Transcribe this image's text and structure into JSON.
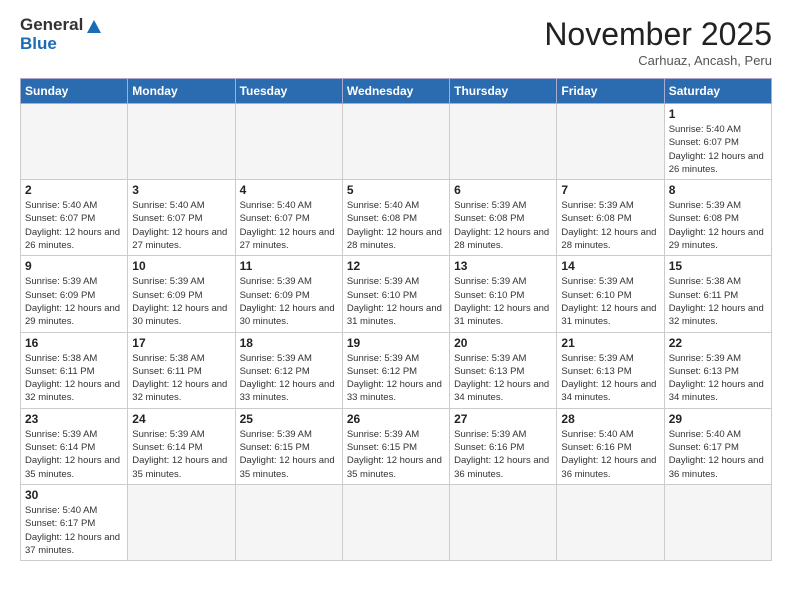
{
  "logo": {
    "line1": "General",
    "line2": "Blue"
  },
  "header": {
    "month": "November 2025",
    "location": "Carhuaz, Ancash, Peru"
  },
  "weekdays": [
    "Sunday",
    "Monday",
    "Tuesday",
    "Wednesday",
    "Thursday",
    "Friday",
    "Saturday"
  ],
  "weeks": [
    [
      {
        "day": "",
        "info": ""
      },
      {
        "day": "",
        "info": ""
      },
      {
        "day": "",
        "info": ""
      },
      {
        "day": "",
        "info": ""
      },
      {
        "day": "",
        "info": ""
      },
      {
        "day": "",
        "info": ""
      },
      {
        "day": "1",
        "info": "Sunrise: 5:40 AM\nSunset: 6:07 PM\nDaylight: 12 hours\nand 26 minutes."
      }
    ],
    [
      {
        "day": "2",
        "info": "Sunrise: 5:40 AM\nSunset: 6:07 PM\nDaylight: 12 hours\nand 26 minutes."
      },
      {
        "day": "3",
        "info": "Sunrise: 5:40 AM\nSunset: 6:07 PM\nDaylight: 12 hours\nand 27 minutes."
      },
      {
        "day": "4",
        "info": "Sunrise: 5:40 AM\nSunset: 6:07 PM\nDaylight: 12 hours\nand 27 minutes."
      },
      {
        "day": "5",
        "info": "Sunrise: 5:40 AM\nSunset: 6:08 PM\nDaylight: 12 hours\nand 28 minutes."
      },
      {
        "day": "6",
        "info": "Sunrise: 5:39 AM\nSunset: 6:08 PM\nDaylight: 12 hours\nand 28 minutes."
      },
      {
        "day": "7",
        "info": "Sunrise: 5:39 AM\nSunset: 6:08 PM\nDaylight: 12 hours\nand 28 minutes."
      },
      {
        "day": "8",
        "info": "Sunrise: 5:39 AM\nSunset: 6:08 PM\nDaylight: 12 hours\nand 29 minutes."
      }
    ],
    [
      {
        "day": "9",
        "info": "Sunrise: 5:39 AM\nSunset: 6:09 PM\nDaylight: 12 hours\nand 29 minutes."
      },
      {
        "day": "10",
        "info": "Sunrise: 5:39 AM\nSunset: 6:09 PM\nDaylight: 12 hours\nand 30 minutes."
      },
      {
        "day": "11",
        "info": "Sunrise: 5:39 AM\nSunset: 6:09 PM\nDaylight: 12 hours\nand 30 minutes."
      },
      {
        "day": "12",
        "info": "Sunrise: 5:39 AM\nSunset: 6:10 PM\nDaylight: 12 hours\nand 31 minutes."
      },
      {
        "day": "13",
        "info": "Sunrise: 5:39 AM\nSunset: 6:10 PM\nDaylight: 12 hours\nand 31 minutes."
      },
      {
        "day": "14",
        "info": "Sunrise: 5:39 AM\nSunset: 6:10 PM\nDaylight: 12 hours\nand 31 minutes."
      },
      {
        "day": "15",
        "info": "Sunrise: 5:38 AM\nSunset: 6:11 PM\nDaylight: 12 hours\nand 32 minutes."
      }
    ],
    [
      {
        "day": "16",
        "info": "Sunrise: 5:38 AM\nSunset: 6:11 PM\nDaylight: 12 hours\nand 32 minutes."
      },
      {
        "day": "17",
        "info": "Sunrise: 5:38 AM\nSunset: 6:11 PM\nDaylight: 12 hours\nand 32 minutes."
      },
      {
        "day": "18",
        "info": "Sunrise: 5:39 AM\nSunset: 6:12 PM\nDaylight: 12 hours\nand 33 minutes."
      },
      {
        "day": "19",
        "info": "Sunrise: 5:39 AM\nSunset: 6:12 PM\nDaylight: 12 hours\nand 33 minutes."
      },
      {
        "day": "20",
        "info": "Sunrise: 5:39 AM\nSunset: 6:13 PM\nDaylight: 12 hours\nand 34 minutes."
      },
      {
        "day": "21",
        "info": "Sunrise: 5:39 AM\nSunset: 6:13 PM\nDaylight: 12 hours\nand 34 minutes."
      },
      {
        "day": "22",
        "info": "Sunrise: 5:39 AM\nSunset: 6:13 PM\nDaylight: 12 hours\nand 34 minutes."
      }
    ],
    [
      {
        "day": "23",
        "info": "Sunrise: 5:39 AM\nSunset: 6:14 PM\nDaylight: 12 hours\nand 35 minutes."
      },
      {
        "day": "24",
        "info": "Sunrise: 5:39 AM\nSunset: 6:14 PM\nDaylight: 12 hours\nand 35 minutes."
      },
      {
        "day": "25",
        "info": "Sunrise: 5:39 AM\nSunset: 6:15 PM\nDaylight: 12 hours\nand 35 minutes."
      },
      {
        "day": "26",
        "info": "Sunrise: 5:39 AM\nSunset: 6:15 PM\nDaylight: 12 hours\nand 35 minutes."
      },
      {
        "day": "27",
        "info": "Sunrise: 5:39 AM\nSunset: 6:16 PM\nDaylight: 12 hours\nand 36 minutes."
      },
      {
        "day": "28",
        "info": "Sunrise: 5:40 AM\nSunset: 6:16 PM\nDaylight: 12 hours\nand 36 minutes."
      },
      {
        "day": "29",
        "info": "Sunrise: 5:40 AM\nSunset: 6:17 PM\nDaylight: 12 hours\nand 36 minutes."
      }
    ],
    [
      {
        "day": "30",
        "info": "Sunrise: 5:40 AM\nSunset: 6:17 PM\nDaylight: 12 hours\nand 37 minutes."
      },
      {
        "day": "",
        "info": ""
      },
      {
        "day": "",
        "info": ""
      },
      {
        "day": "",
        "info": ""
      },
      {
        "day": "",
        "info": ""
      },
      {
        "day": "",
        "info": ""
      },
      {
        "day": "",
        "info": ""
      }
    ]
  ]
}
